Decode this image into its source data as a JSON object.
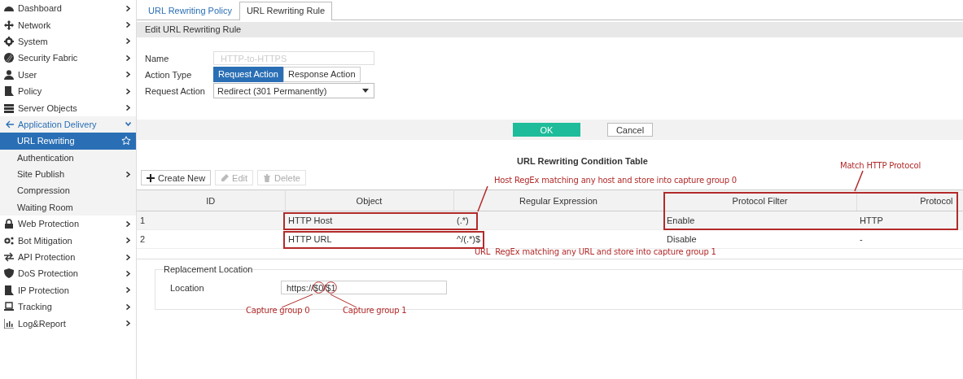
{
  "sidebar": {
    "items": [
      {
        "label": "Dashboard",
        "has_submenu": true,
        "expanded": false
      },
      {
        "label": "Network",
        "has_submenu": true,
        "expanded": false
      },
      {
        "label": "System",
        "has_submenu": true,
        "expanded": false
      },
      {
        "label": "Security Fabric",
        "has_submenu": true,
        "expanded": false
      },
      {
        "label": "User",
        "has_submenu": true,
        "expanded": false
      },
      {
        "label": "Policy",
        "has_submenu": true,
        "expanded": false
      },
      {
        "label": "Server Objects",
        "has_submenu": true,
        "expanded": false
      },
      {
        "label": "Application Delivery",
        "has_submenu": true,
        "expanded": true,
        "children": [
          {
            "label": "URL Rewriting",
            "has_submenu": false,
            "selected": true
          },
          {
            "label": "Authentication",
            "has_submenu": false,
            "selected": false
          },
          {
            "label": "Site Publish",
            "has_submenu": true,
            "selected": false
          },
          {
            "label": "Compression",
            "has_submenu": false,
            "selected": false
          },
          {
            "label": "Waiting Room",
            "has_submenu": false,
            "selected": false
          }
        ]
      },
      {
        "label": "Web Protection",
        "has_submenu": true,
        "expanded": false
      },
      {
        "label": "Bot Mitigation",
        "has_submenu": true,
        "expanded": false
      },
      {
        "label": "API Protection",
        "has_submenu": true,
        "expanded": false
      },
      {
        "label": "DoS Protection",
        "has_submenu": true,
        "expanded": false
      },
      {
        "label": "IP Protection",
        "has_submenu": true,
        "expanded": false
      },
      {
        "label": "Tracking",
        "has_submenu": true,
        "expanded": false
      },
      {
        "label": "Log&Report",
        "has_submenu": true,
        "expanded": false
      }
    ]
  },
  "tabs": [
    {
      "label": "URL Rewriting Policy",
      "selected": false
    },
    {
      "label": "URL Rewriting Rule",
      "selected": true
    }
  ],
  "section_title": "Edit URL Rewriting Rule",
  "form": {
    "name": {
      "label": "Name",
      "placeholder": "HTTP-to-HTTPS"
    },
    "action_type": {
      "label": "Action Type",
      "options": [
        {
          "label": "Request Action",
          "selected": true
        },
        {
          "label": "Response Action",
          "selected": false
        }
      ]
    },
    "request_action": {
      "label": "Request Action",
      "value": "Redirect (301 Permanently)"
    }
  },
  "buttons": [
    {
      "label": "OK",
      "kind": "primary"
    },
    {
      "label": "Cancel",
      "kind": "secondary"
    }
  ],
  "table": {
    "title": "URL Rewriting Condition Table",
    "toolbar": [
      {
        "label": "Create New",
        "kind": "create",
        "disabled": false
      },
      {
        "label": "Edit",
        "kind": "edit",
        "disabled": true
      },
      {
        "label": "Delete",
        "kind": "delete",
        "disabled": true
      }
    ],
    "columns": [
      "ID",
      "Object",
      "Regular Expression",
      "Protocol Filter",
      "Protocol"
    ],
    "rows": [
      [
        "1",
        "HTTP Host",
        "(.*)",
        "Enable",
        "HTTP"
      ],
      [
        "2",
        "HTTP URL",
        "^/(.*)$",
        "Disable",
        "-"
      ]
    ]
  },
  "replacement": {
    "legend": "Replacement Location",
    "label": "Location",
    "value": "https://$0/$1"
  },
  "annotations": [
    {
      "text": "Host RegEx matching any host and store into capture group 0"
    },
    {
      "text": "Match HTTP Protocol"
    },
    {
      "text": "URL  RegEx matching any URL and store into capture group 1"
    },
    {
      "text": "Capture group 0"
    },
    {
      "text": "Capture group 1"
    }
  ]
}
